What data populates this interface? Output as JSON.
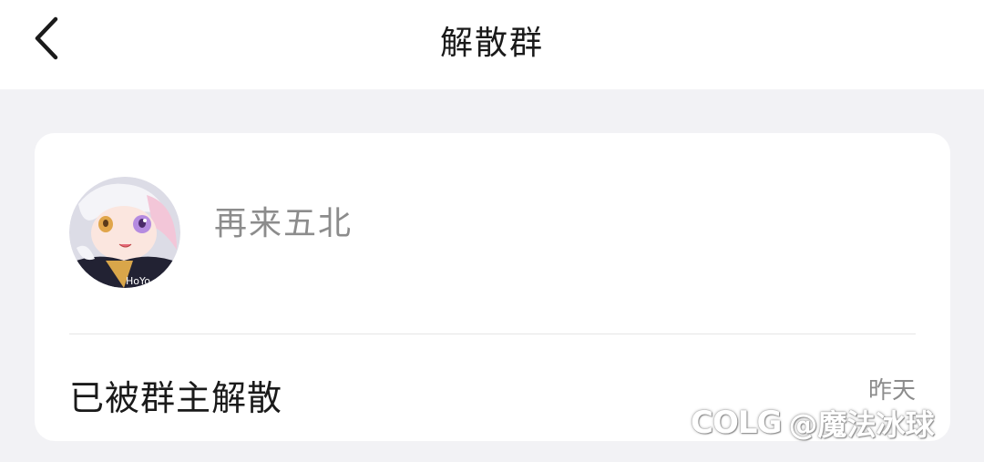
{
  "header": {
    "title": "解散群",
    "back_icon": "chevron-left-icon"
  },
  "card": {
    "group_name": "再来五北",
    "avatar_icon": "anime-character-avatar",
    "status": "已被群主解散",
    "time": "昨天"
  },
  "watermark": {
    "logo": "COLG",
    "handle": "@魔法冰球"
  },
  "colors": {
    "background": "#f2f2f5",
    "card": "#ffffff",
    "primary_text": "#1a1a1a",
    "secondary_text": "#8c8c8c"
  }
}
